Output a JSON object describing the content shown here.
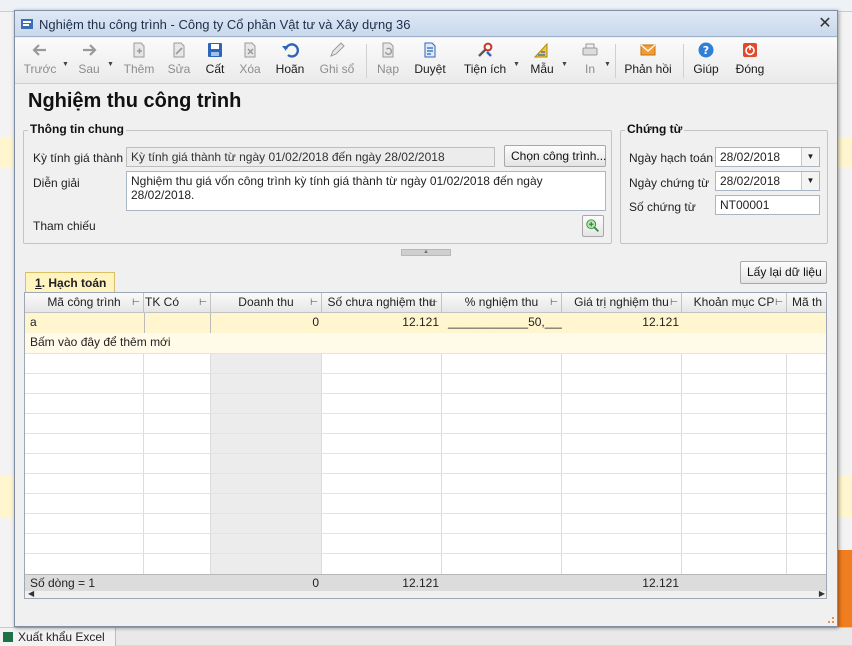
{
  "window": {
    "title": "Nghiệm thu công trình - Công ty Cổ phần Vật tư và Xây dựng 36",
    "close_glyph": "✕"
  },
  "toolbar": {
    "buttons": [
      {
        "label": "Trước",
        "icon": "arrow-left-icon",
        "enabled": false
      },
      {
        "label": "Sau",
        "icon": "arrow-right-icon",
        "enabled": false
      },
      {
        "label": "Thêm",
        "icon": "add-document-icon",
        "enabled": false
      },
      {
        "label": "Sửa",
        "icon": "edit-document-icon",
        "enabled": false
      },
      {
        "label": "Cất",
        "icon": "save-icon",
        "enabled": true
      },
      {
        "label": "Xóa",
        "icon": "delete-icon",
        "enabled": false
      },
      {
        "label": "Hoãn",
        "icon": "undo-icon",
        "enabled": true
      },
      {
        "label": "Ghi sổ",
        "icon": "pencil-icon",
        "enabled": false
      },
      {
        "label": "Nạp",
        "icon": "reload-icon",
        "enabled": false
      },
      {
        "label": "Duyệt",
        "icon": "document-check-icon",
        "enabled": true
      },
      {
        "label": "Tiện ích",
        "icon": "tools-icon",
        "enabled": true
      },
      {
        "label": "Mẫu",
        "icon": "template-icon",
        "enabled": true
      },
      {
        "label": "In",
        "icon": "printer-icon",
        "enabled": false
      },
      {
        "label": "Phản hồi",
        "icon": "mail-icon",
        "enabled": true
      },
      {
        "label": "Giúp",
        "icon": "help-icon",
        "enabled": true
      },
      {
        "label": "Đóng",
        "icon": "power-icon",
        "enabled": true
      }
    ]
  },
  "page_title": "Nghiệm thu công trình",
  "general_info": {
    "legend": "Thông tin chung",
    "period_label": "Kỳ tính giá thành",
    "period_value": "Kỳ tính giá thành từ ngày 01/02/2018 đến ngày 28/02/2018",
    "choose_button": "Chọn công trình...",
    "description_label": "Diễn giải",
    "description_value": "Nghiệm thu giá vốn công trình kỳ tính giá thành từ ngày 01/02/2018 đến ngày 28/02/2018.",
    "reference_label": "Tham chiếu"
  },
  "voucher": {
    "legend": "Chứng từ",
    "posting_date_label": "Ngày hạch toán",
    "posting_date_value": "28/02/2018",
    "voucher_date_label": "Ngày chứng từ",
    "voucher_date_value": "28/02/2018",
    "voucher_no_label": "Số chứng từ",
    "voucher_no_value": "NT00001"
  },
  "reload_button": "Lấy lại dữ liệu",
  "tab": {
    "number": "1",
    "label": ". Hạch toán"
  },
  "grid": {
    "columns": [
      "Mã công trình",
      "TK Có",
      "Doanh thu",
      "Số chưa nghiệm thu",
      "% nghiệm thu",
      "Giá trị nghiệm thu",
      "Khoản mục CP",
      "Mã th"
    ],
    "rows": [
      {
        "ma_cong_trinh": "a",
        "tk_co": "",
        "doanh_thu": "0",
        "so_chua_nghiem_thu": "12.121",
        "pct_nghiem_thu": "____________50,____",
        "gia_tri_nghiem_thu": "12.121",
        "khoan_muc_cp": "",
        "ma_th": ""
      }
    ],
    "new_row_hint": "Bấm vào đây để thêm mới",
    "footer": {
      "count": "Số dòng = 1",
      "doanh_thu": "0",
      "so_chua_nghiem_thu": "12.121",
      "gia_tri_nghiem_thu": "12.121"
    }
  },
  "background": {
    "bottom_tab": "Xuất khẩu Excel"
  },
  "colors": {
    "accent_yellow": "#fff6cf",
    "title_blue": "#1d2f48",
    "orange": "#f07d1f"
  }
}
